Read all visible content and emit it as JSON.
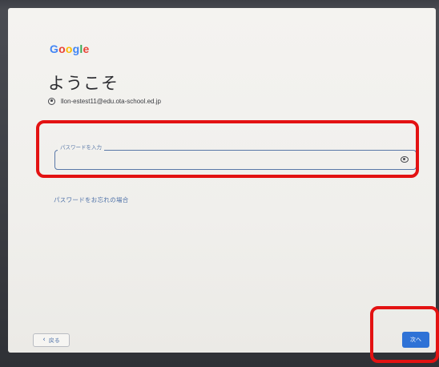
{
  "logo": {
    "letters": [
      "G",
      "o",
      "o",
      "g",
      "l",
      "e"
    ],
    "colors": [
      "#4285F4",
      "#EA4335",
      "#FBBC05",
      "#4285F4",
      "#34A853",
      "#EA4335"
    ]
  },
  "title": "ようこそ",
  "account": {
    "email": "llon-estest11@edu.ota-school.ed.jp",
    "icon": "account-circle-icon"
  },
  "password_field": {
    "label": "パスワードを入力",
    "value": "",
    "icon": "eye-icon"
  },
  "forgot_link": "パスワードをお忘れの場合",
  "back_button": {
    "chevron": "‹",
    "label": "戻る"
  },
  "next_button": {
    "label": "次へ"
  },
  "colors": {
    "accent": "#2f72d6",
    "link": "#4f72a8",
    "annotation": "#e31212"
  }
}
